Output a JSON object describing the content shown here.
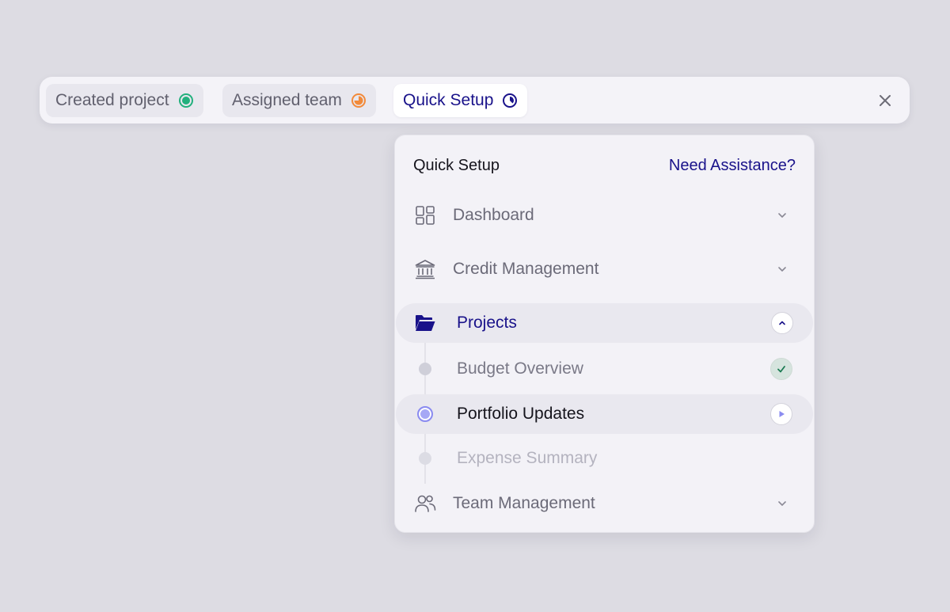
{
  "steps_bar": {
    "steps": [
      {
        "label": "Created project",
        "status": "complete",
        "status_color": "#22b07d"
      },
      {
        "label": "Assigned team",
        "status": "in-progress",
        "status_color": "#f28a3a"
      },
      {
        "label": "Quick Setup",
        "status": "active",
        "status_color": "#19128a"
      }
    ],
    "close_icon": "close-icon"
  },
  "panel": {
    "title": "Quick Setup",
    "help_link": "Need Assistance?",
    "sections": [
      {
        "label": "Dashboard",
        "icon": "dashboard-icon",
        "state": "collapsed"
      },
      {
        "label": "Credit Management",
        "icon": "bank-icon",
        "state": "collapsed"
      },
      {
        "label": "Projects",
        "icon": "folder-open-icon",
        "state": "expanded"
      },
      {
        "label": "Team Management",
        "icon": "users-icon",
        "state": "collapsed"
      }
    ],
    "project_tasks": [
      {
        "label": "Budget Overview",
        "state": "done"
      },
      {
        "label": "Portfolio Updates",
        "state": "current"
      },
      {
        "label": "Expense Summary",
        "state": "pending"
      }
    ]
  },
  "colors": {
    "accent": "#19128a",
    "success": "#22b07d",
    "warning": "#f28a3a",
    "current_step": "#8b8cf0",
    "page_background": "#dddce3"
  }
}
